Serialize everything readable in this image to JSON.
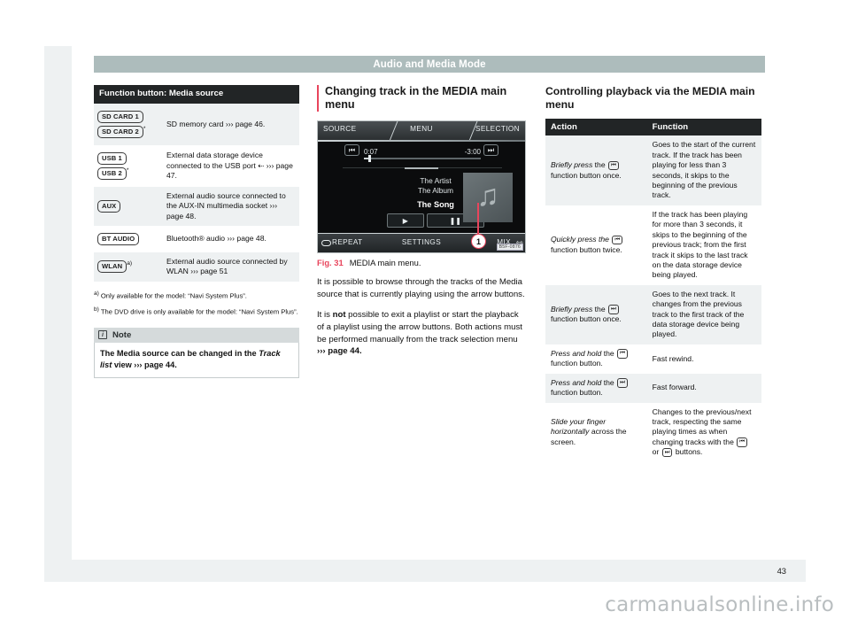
{
  "running_head": "Audio and Media Mode",
  "page_number": "43",
  "watermark": "carmanualsonline.info",
  "media_source_table": {
    "header": "Function button: Media source",
    "rows": [
      {
        "buttons": [
          "SD CARD 1",
          "SD CARD 2"
        ],
        "button_marks": [
          "",
          "*"
        ],
        "description": "SD memory card ››› page 46."
      },
      {
        "buttons": [
          "USB 1",
          "USB 2"
        ],
        "button_marks": [
          "",
          "*"
        ],
        "description": "External data storage device connected to the USB port ⇠ ››› page 47."
      },
      {
        "buttons": [
          "AUX"
        ],
        "button_marks": [
          ""
        ],
        "description": "External audio source connected to the AUX-IN multimedia socket ››› page 48."
      },
      {
        "buttons": [
          "BT AUDIO"
        ],
        "button_marks": [
          ""
        ],
        "description": "Bluetooth® audio ››› page 48."
      },
      {
        "buttons": [
          "WLAN"
        ],
        "button_marks": [
          "a)"
        ],
        "description": "External audio source connected by WLAN ››› page 51"
      }
    ]
  },
  "footnotes": [
    {
      "mark": "a)",
      "text": "Only available for the model: “Navi System Plus”."
    },
    {
      "mark": "b)",
      "text": "The DVD drive is only available for the model: “Navi System Plus”."
    }
  ],
  "note": {
    "icon": "info-icon",
    "title": "Note",
    "text_before": "The Media source can be changed in the ",
    "text_italic": "Track list",
    "text_after": " view ››› page 44."
  },
  "middle_column": {
    "heading": "Changing track in the MEDIA main menu",
    "figure": {
      "caption_number": "Fig. 31",
      "caption_text": "MEDIA main menu.",
      "image_code": "B5F-0876",
      "callout_number": "1",
      "screen": {
        "top_labels": {
          "left": "SOURCE",
          "center": "MENU",
          "right": "SELECTION"
        },
        "bottom_labels": {
          "left": "REPEAT",
          "center": "SETTINGS",
          "right": "MIX"
        },
        "elapsed_time": "0:07",
        "remaining_time": "-3:00",
        "artist": "The Artist",
        "album": "The Album",
        "song": "The Song",
        "prev_icon": "skip-previous-icon",
        "next_icon": "skip-next-icon",
        "playmode_icon": "play-star-icon",
        "pause_icon": "pause-icon",
        "album_art_icon": "music-note-icon",
        "repeat_icon": "repeat-icon",
        "mix_icon": "shuffle-icon"
      }
    },
    "paragraphs": [
      {
        "parts": [
          {
            "type": "text",
            "value": "It is possible to browse through the tracks of the Media source that is currently playing using the arrow buttons."
          }
        ]
      },
      {
        "parts": [
          {
            "type": "text",
            "value": "It is "
          },
          {
            "type": "bold",
            "value": "not"
          },
          {
            "type": "text",
            "value": " possible to exit a playlist or start the playback of a playlist using the arrow buttons. Both actions must be performed manually from the track selection menu "
          },
          {
            "type": "bold",
            "value": "››› page 44."
          }
        ]
      }
    ]
  },
  "playback_table": {
    "heading": "Controlling playback via the MEDIA main menu",
    "columns": [
      "Action",
      "Function"
    ],
    "rows": [
      {
        "action_italic": "Briefly press",
        "action_mid": " the ",
        "action_icon": "skip-previous-icon",
        "action_end": " function button once.",
        "function": "Goes to the start of the current track. If the track has been playing for less than 3 seconds, it skips to the beginning of the previous track."
      },
      {
        "action_italic": "Quickly press the",
        "action_mid": " ",
        "action_icon": "skip-previous-icon",
        "action_end": " function button twice.",
        "function": "If the track has been playing for more than 3 seconds, it skips to the beginning of the previous track; from the first track it skips to the last track on the data storage device being played."
      },
      {
        "action_italic": "Briefly press",
        "action_mid": " the ",
        "action_icon": "skip-next-icon",
        "action_end": " function button once.",
        "function": "Goes to the next track. It changes from the previous track to the first track of the data storage device being played."
      },
      {
        "action_italic": "Press and hold",
        "action_mid": " the ",
        "action_icon": "skip-previous-icon",
        "action_end": " function button.",
        "function": "Fast rewind."
      },
      {
        "action_italic": "Press and hold",
        "action_mid": " the ",
        "action_icon": "skip-next-icon",
        "action_end": " function button.",
        "function": "Fast forward."
      },
      {
        "action_italic": "Slide your finger horizontally",
        "action_mid": " across the screen.",
        "action_icon": "",
        "action_end": "",
        "function_prefix": "Changes to the previous/next track, respecting the same playing times as when changing tracks with the ",
        "function_icon_a": "skip-previous-icon",
        "function_mid": " or ",
        "function_icon_b": "skip-next-icon",
        "function_suffix": " buttons."
      }
    ]
  },
  "colors": {
    "accent_red": "#e8455c",
    "header_band": "#adbcbc",
    "table_header": "#222526",
    "zebra": "#eef1f2",
    "note_header": "#d5dadb"
  }
}
